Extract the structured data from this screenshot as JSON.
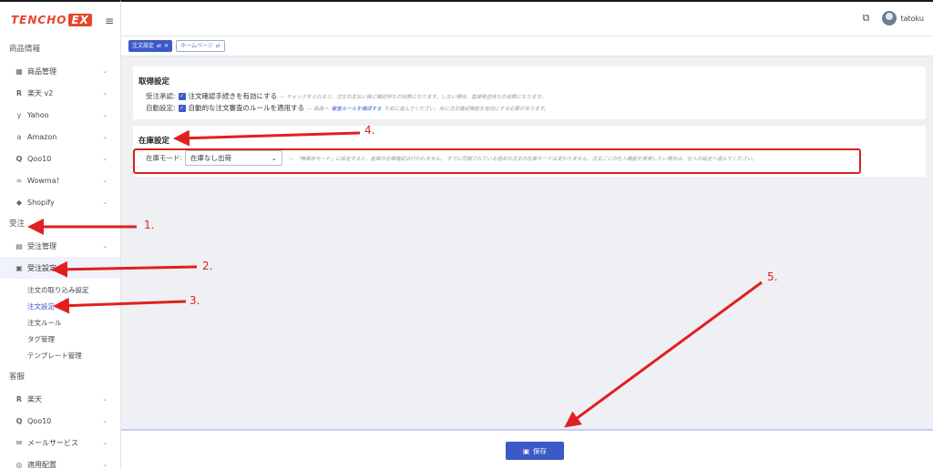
{
  "logo": {
    "part1": "TENCHO",
    "part2": "EX"
  },
  "sidebar": {
    "section_product": "商品情報",
    "product_items": [
      {
        "label": "商品管理",
        "icon": "grid-icon"
      },
      {
        "label": "楽天 v2",
        "icon": "rakuten-icon"
      },
      {
        "label": "Yahoo",
        "icon": "yahoo-icon"
      },
      {
        "label": "Amazon",
        "icon": "amazon-icon"
      },
      {
        "label": "Qoo10",
        "icon": "qoo10-icon"
      },
      {
        "label": "Wowma！",
        "icon": "wowma-icon"
      },
      {
        "label": "Shopify",
        "icon": "shopify-icon"
      }
    ],
    "section_order": "受注",
    "order_items": [
      {
        "label": "受注管理",
        "icon": "clipboard-icon"
      },
      {
        "label": "受注設定",
        "icon": "order-settings-icon"
      }
    ],
    "order_sub_items": [
      "注文の取り込み設定",
      "注文設定",
      "注文ルール",
      "タグ管理",
      "テンプレート管理"
    ],
    "section_customer": "客服",
    "customer_items": [
      {
        "label": "楽天",
        "icon": "rakuten-icon"
      },
      {
        "label": "Qoo10",
        "icon": "qoo10-icon"
      },
      {
        "label": "メールサービス",
        "icon": "mail-icon"
      },
      {
        "label": "適用配置",
        "icon": "config-icon"
      }
    ]
  },
  "topbar": {
    "username": "tatoku"
  },
  "tabs": [
    {
      "label": "注文設定",
      "active": true
    },
    {
      "label": "ホームページ",
      "active": false
    }
  ],
  "acquire": {
    "title": "取得設定",
    "approval_label": "受注承認:",
    "approval_text": "注文確認手続きを有効にする",
    "approval_help": "— チェックを入れると、注文の支払い後に確認待ちの状態になります。しない場合、直接発送待ちの状態になります。",
    "auto_label": "自動設定:",
    "auto_text": "自動的な注文審査のルールを適用する",
    "auto_help_pre": "— 画面へ",
    "auto_link": "審査ルールを構成する",
    "auto_help_post": "ために進んでください。尚に注文確認機能を有効にする必要があります。"
  },
  "stock": {
    "title": "在庫設定",
    "mode_label": "在庫モード:",
    "mode_value": "在庫なし出荷",
    "mode_help": "— 「無庫存モード」に設定すると、倉庫の在庫確認は行われません。 すでに同期されている過去の注文の在庫モードは変わりません。注文ごとの仕入機能を使用したい場合は、仕入の設定へ進んでください。"
  },
  "save_button": "保存",
  "annotations": [
    "1.",
    "2.",
    "3.",
    "4.",
    "5."
  ],
  "colors": {
    "accent": "#3c59c8",
    "annotation_red": "#e02020",
    "logo_red": "#e8442a"
  }
}
